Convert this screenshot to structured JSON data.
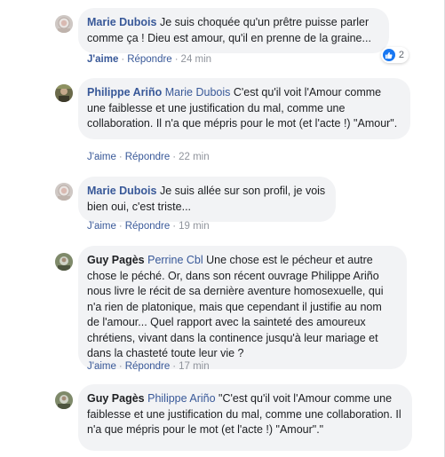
{
  "comments": [
    {
      "author": "Marie Dubois",
      "mention": "",
      "text": "Je suis choquée qu'un prêtre puisse parler comme ça ! Dieu est amour, qu'il en prenne de la graine...",
      "like": "J'aime",
      "reply": "Répondre",
      "time": "24 min",
      "reaction_icon": "like-icon",
      "reaction_count": "2",
      "avatar": "marie-dubois-avatar"
    },
    {
      "author": "Philippe Ariño",
      "mention": "Marie Dubois",
      "text": "C'est qu'il voit l'Amour comme une faiblesse et une justification du mal, comme une collaboration. Il n'a que mépris pour le mot (et l'acte !) \"Amour\".",
      "like": "J'aime",
      "reply": "Répondre",
      "time": "22 min",
      "avatar": "philippe-arino-avatar"
    },
    {
      "author": "Marie Dubois",
      "mention": "",
      "text": "Je suis allée sur son profil, je vois bien oui, c'est triste...",
      "like": "J'aime",
      "reply": "Répondre",
      "time": "19 min",
      "avatar": "marie-dubois-avatar"
    },
    {
      "author": "Guy Pagès",
      "mention": "Perrine Cbl",
      "text": "Une chose est le pécheur et autre chose le péché. Or, dans son récent ouvrage Philippe Ariño nous livre le récit de sa dernière aventure homosexuelle, qui n'a rien de platonique, mais que cependant il justifie au nom de l'amour... Quel rapport avec la sainteté des amoureux chrétiens, vivant dans la continence jusqu'à leur mariage et dans la chasteté toute leur vie ?",
      "like": "J'aime",
      "reply": "Répondre",
      "time": "17 min",
      "avatar": "guy-pages-avatar"
    },
    {
      "author": "Guy Pagès",
      "mention": "Philippe Ariño",
      "text": "\"C'est qu'il voit l'Amour comme une faiblesse et une justification du mal, comme une collaboration. Il n'a que mépris pour le mot (et l'acte !) \"Amour\".\"",
      "avatar": "guy-pages-avatar"
    }
  ],
  "colors": {
    "link": "#385898",
    "bubble": "#f2f3f5",
    "meta": "#90949c",
    "like": "#1877f2"
  }
}
